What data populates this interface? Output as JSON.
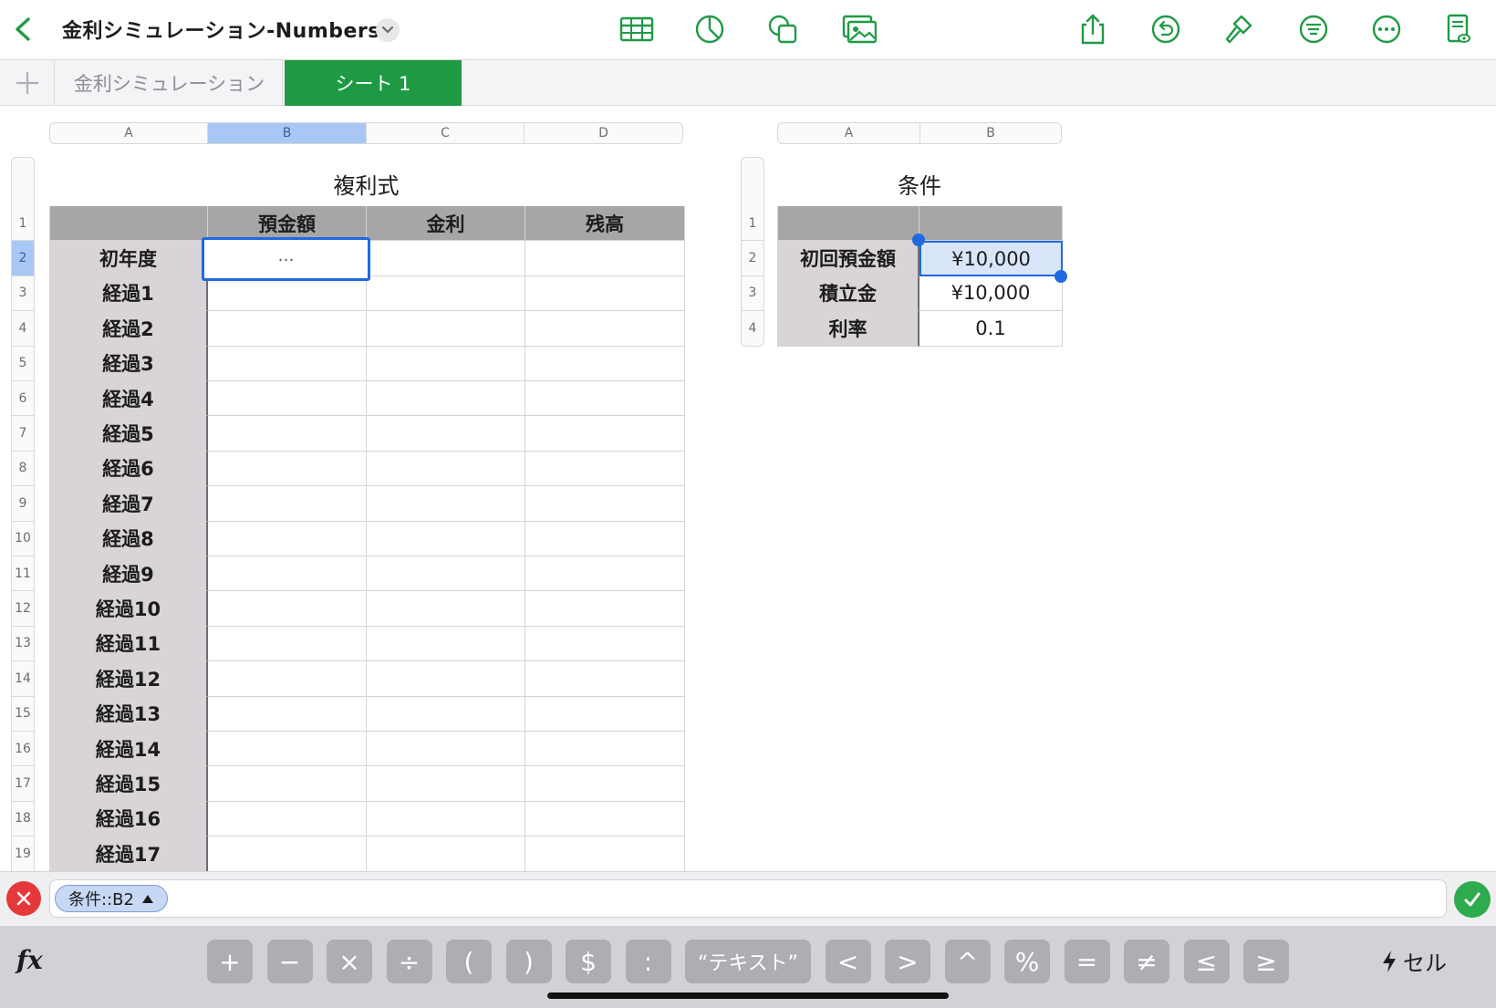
{
  "app": {
    "doc_title": "金利シミュレーション-Numbers"
  },
  "toolbar": {
    "icons": [
      "back-chevron-icon",
      "table-icon",
      "chart-icon",
      "shape-icon",
      "media-icon",
      "share-icon",
      "undo-icon",
      "format-brush-icon",
      "filter-icon",
      "more-icon",
      "view-options-icon"
    ]
  },
  "tabs": {
    "items": [
      {
        "label": "金利シミュレーション",
        "active": false
      },
      {
        "label": "シート 1",
        "active": true
      }
    ]
  },
  "left_table": {
    "title": "複利式",
    "columns": [
      "A",
      "B",
      "C",
      "D"
    ],
    "header_row": [
      "",
      "預金額",
      "金利",
      "残高"
    ],
    "rows": [
      "初年度",
      "経過1",
      "経過2",
      "経過3",
      "経過4",
      "経過5",
      "経過6",
      "経過7",
      "経過8",
      "経過9",
      "経過10",
      "経過11",
      "経過12",
      "経過13",
      "経過14",
      "経過15",
      "経過16",
      "経過17"
    ],
    "row_numbers": [
      "1",
      "2",
      "3",
      "4",
      "5",
      "6",
      "7",
      "8",
      "9",
      "10",
      "11",
      "12",
      "13",
      "14",
      "15",
      "16",
      "17",
      "18",
      "19"
    ],
    "editing_cell_text": "…"
  },
  "right_table": {
    "title": "条件",
    "columns": [
      "A",
      "B"
    ],
    "row_numbers": [
      "1",
      "2",
      "3",
      "4"
    ],
    "rows": [
      {
        "label": "初回預金額",
        "value": "¥10,000"
      },
      {
        "label": "積立金",
        "value": "¥10,000"
      },
      {
        "label": "利率",
        "value": "0.1"
      }
    ]
  },
  "formula_bar": {
    "token": "条件::B2"
  },
  "keyboard": {
    "fx": "fx",
    "keys": [
      "+",
      "−",
      "×",
      "÷",
      "(",
      ")",
      "$",
      ":",
      "“テキスト”",
      "<",
      ">",
      "^",
      "%",
      "=",
      "≠",
      "≤",
      "≥"
    ],
    "cell_label": "セル"
  },
  "colors": {
    "accent_green": "#1f9a44",
    "selection_blue": "#1f6ae0",
    "cancel_red": "#e5383b",
    "confirm_green": "#2eaa4f"
  }
}
